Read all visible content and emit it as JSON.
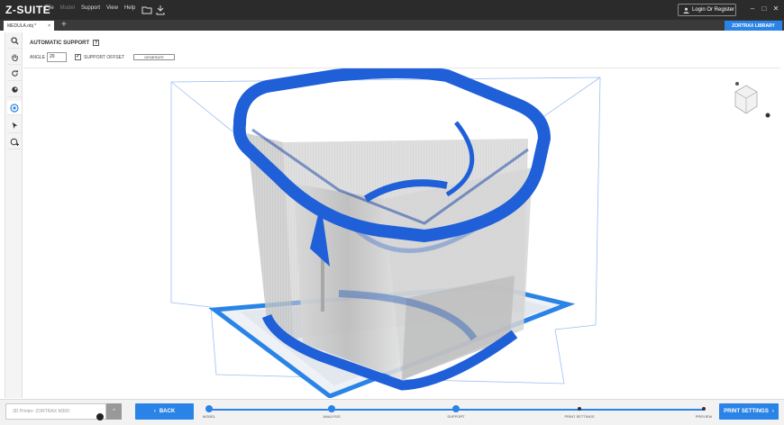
{
  "app": {
    "logo": "Z-SUITE",
    "menu": [
      "File",
      "Model",
      "Support",
      "View",
      "Help"
    ],
    "login_label": "Login Or Register",
    "library_label": "ZORTRAX LIBRARY"
  },
  "tab": {
    "name": "MEDULA.obj *",
    "close": "×",
    "add": "+"
  },
  "support_panel": {
    "title": "AUTOMATIC SUPPORT",
    "help": "?",
    "angle_label": "ANGLE",
    "angle_value": "20",
    "offset_checked": true,
    "offset_label": "SUPPORT OFFSET",
    "generate_label": "GENERATE"
  },
  "left_tools": [
    "search-icon",
    "hand-icon",
    "rotate-icon",
    "view-icon",
    "support-icon",
    "pointer-icon",
    "add-support-icon"
  ],
  "bottom": {
    "printer_placeholder": "3D Printer: ZORTRAX M300",
    "back_label": "BACK",
    "print_label": "PRINT SETTINGS",
    "steps": [
      {
        "label": "MODEL",
        "done": true
      },
      {
        "label": "ANALYSIS",
        "done": true
      },
      {
        "label": "SUPPORT",
        "done": true
      },
      {
        "label": "PRINT SETTINGS",
        "done": false
      },
      {
        "label": "PREVIEW",
        "done": false
      }
    ]
  },
  "colors": {
    "accent": "#2a83e6",
    "model": "#1f5fd8",
    "titlebar": "#2b2b2b"
  }
}
